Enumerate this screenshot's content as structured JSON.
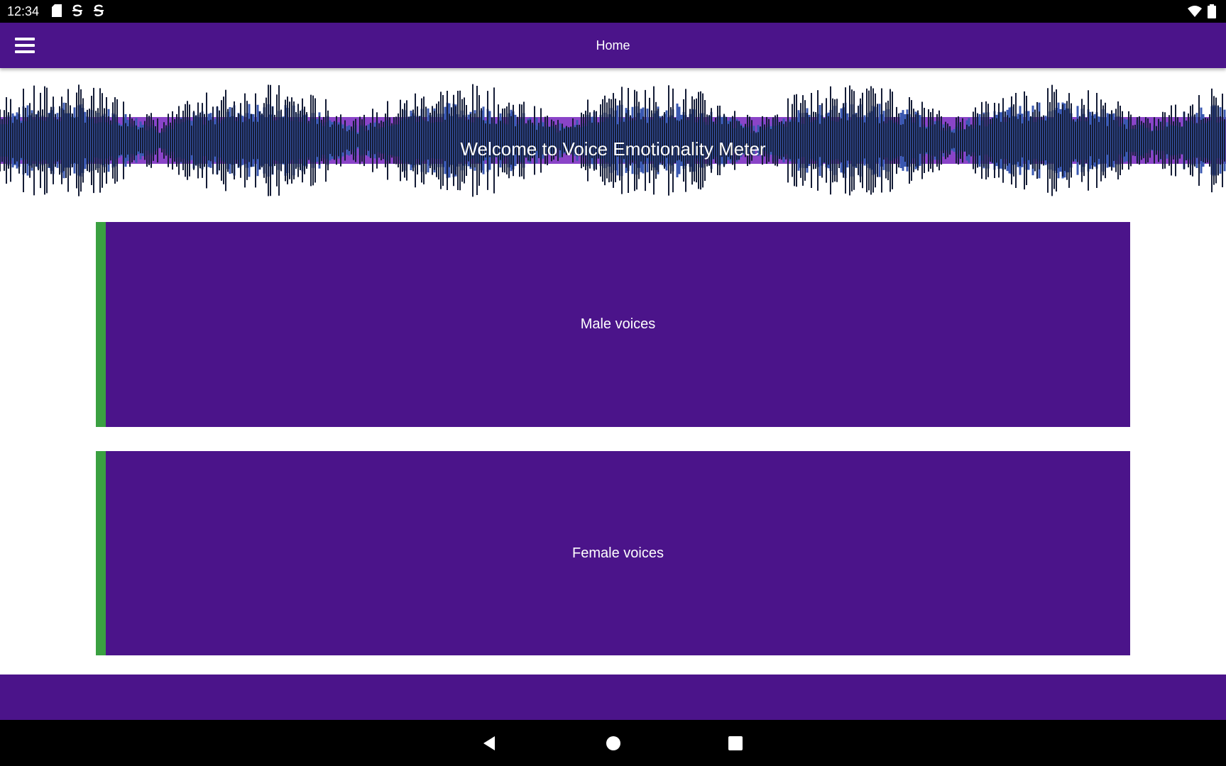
{
  "status_bar": {
    "time": "12:34",
    "left_icons": [
      "sd-card-icon",
      "sync-icon",
      "sync-icon"
    ],
    "right_icons": [
      "wifi-icon",
      "battery-icon"
    ]
  },
  "app_bar": {
    "title": "Home",
    "menu_icon": "hamburger-menu-icon"
  },
  "banner": {
    "text": "Welcome to Voice Emotionality Meter"
  },
  "cards": {
    "male": {
      "label": "Male voices"
    },
    "female": {
      "label": "Female voices"
    }
  },
  "nav": {
    "back_icon": "back-triangle-icon",
    "home_icon": "home-circle-icon",
    "recents_icon": "recents-square-icon"
  },
  "colors": {
    "primary": "#4b148a",
    "accent": "#3aa041",
    "banner_stripe": "#8a44c8",
    "waveform_dark": "#141c36",
    "waveform_blue": "#3a58b0"
  }
}
